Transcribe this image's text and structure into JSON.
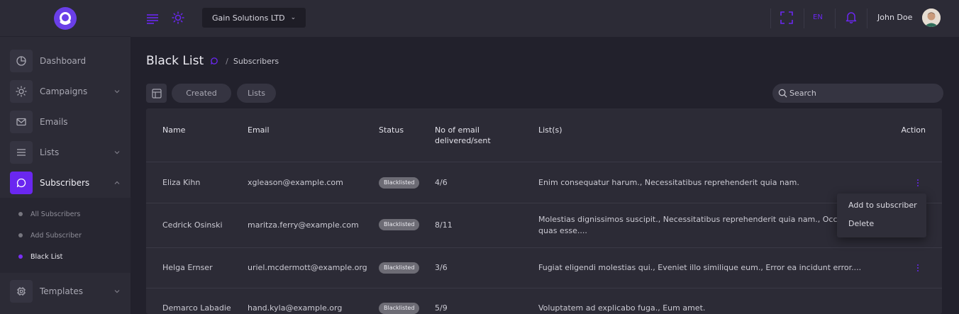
{
  "sidebar": {
    "items": [
      {
        "label": "Dashboard",
        "icon": "pie-chart-icon"
      },
      {
        "label": "Campaigns",
        "icon": "sun-icon"
      },
      {
        "label": "Emails",
        "icon": "mail-icon"
      },
      {
        "label": "Lists",
        "icon": "list-icon"
      },
      {
        "label": "Subscribers",
        "icon": "message-circle-icon"
      },
      {
        "label": "Templates",
        "icon": "chip-icon"
      }
    ],
    "subitems": [
      "All Subscribers",
      "Add Subscriber",
      "Black List"
    ]
  },
  "topbar": {
    "company": "Gain Solutions LTD",
    "language": "EN",
    "user_name": "John Doe"
  },
  "page": {
    "title": "Black List",
    "breadcrumb": "Subscribers"
  },
  "filters": {
    "created_label": "Created",
    "lists_label": "Lists",
    "search_placeholder": "Search"
  },
  "table": {
    "columns": {
      "name": "Name",
      "email": "Email",
      "status": "Status",
      "delivered_line1": "No of email",
      "delivered_line2": "delivered/sent",
      "lists": "List(s)",
      "action": "Action"
    },
    "rows": [
      {
        "name": "Eliza Kihn",
        "email": "xgleason@example.com",
        "status": "Blacklisted",
        "delivered": "4/6",
        "lists_line1": "Enim consequatur harum., Necessitatibus reprehenderit quia nam.",
        "lists_line2": ""
      },
      {
        "name": "Cedrick Osinski",
        "email": "maritza.ferry@example.com",
        "status": "Blacklisted",
        "delivered": "8/11",
        "lists_line1": "Molestias dignissimos suscipit., Necessitatibus reprehenderit quia nam., Occaecati",
        "lists_line2": "quas esse...."
      },
      {
        "name": "Helga Ernser",
        "email": "uriel.mcdermott@example.org",
        "status": "Blacklisted",
        "delivered": "3/6",
        "lists_line1": "Fugiat eligendi molestias qui., Eveniet illo similique eum., Error ea incidunt error....",
        "lists_line2": ""
      },
      {
        "name": "Demarco Labadie",
        "email": "hand.kyla@example.org",
        "status": "Blacklisted",
        "delivered": "5/9",
        "lists_line1": "Voluptatem ad explicabo fuga., Eum amet.",
        "lists_line2": ""
      }
    ]
  },
  "dropdown": {
    "items": [
      "Add to subscriber",
      "Delete"
    ]
  },
  "colors": {
    "accent": "#6a27f0",
    "background": "#22212c",
    "panel": "#2c2b36",
    "badge": "#6d6c75"
  }
}
